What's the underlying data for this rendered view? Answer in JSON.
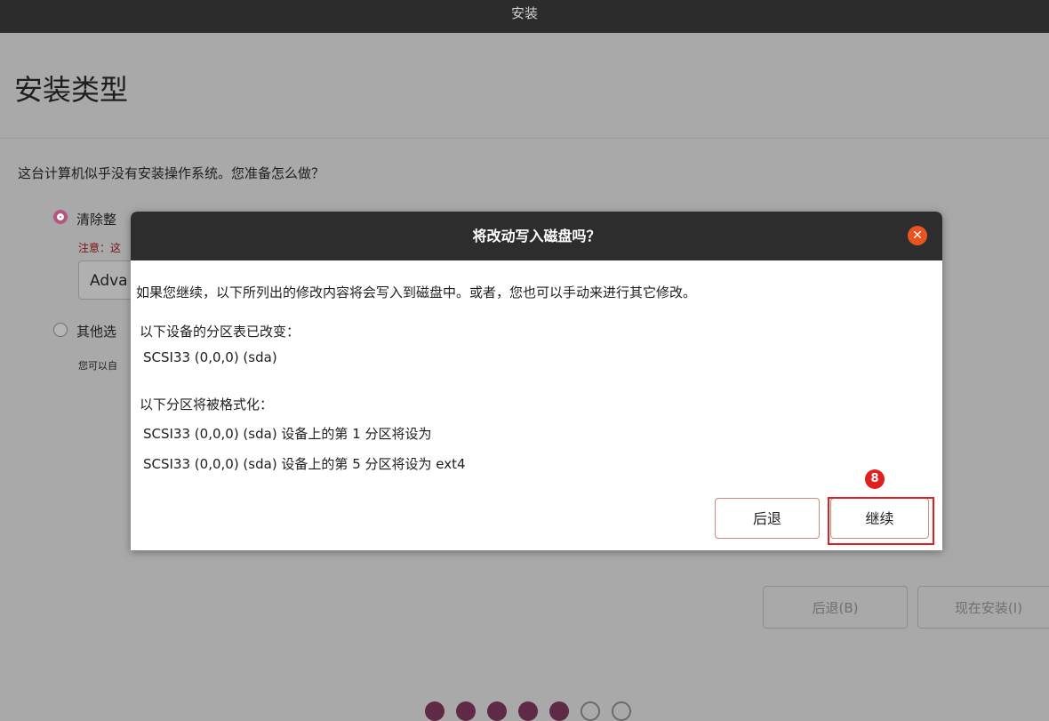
{
  "window": {
    "title": "安装"
  },
  "page": {
    "title": "安装类型",
    "question": "这台计算机似乎没有安装操作系统。您准备怎么做？",
    "option1_label": "清除整",
    "option1_note": "注意：这",
    "option1_combo": "Adva",
    "option2_label": "其他选",
    "option2_desc": "您可以自"
  },
  "dialog": {
    "title": "将改动写入磁盘吗？",
    "close_icon": "close-icon",
    "intro": "如果您继续，以下所列出的修改内容将会写入到磁盘中。或者，您也可以手动来进行其它修改。",
    "partition_table_heading": "以下设备的分区表已改变：",
    "partition_table_device": "SCSI33 (0,0,0) (sda)",
    "format_heading": "以下分区将被格式化：",
    "format_items": [
      "SCSI33 (0,0,0) (sda) 设备上的第 1 分区将设为",
      "SCSI33 (0,0,0) (sda) 设备上的第 5 分区将设为 ext4"
    ],
    "back_label": "后退",
    "continue_label": "继续"
  },
  "annotation": {
    "step_number": "8"
  },
  "footer": {
    "back_label": "后退(B)",
    "install_label": "现在安装(I)",
    "progress_total": 7,
    "progress_filled": 5
  },
  "colors": {
    "accent": "#e95420",
    "highlight": "#e02020",
    "radio": "#b25782"
  }
}
